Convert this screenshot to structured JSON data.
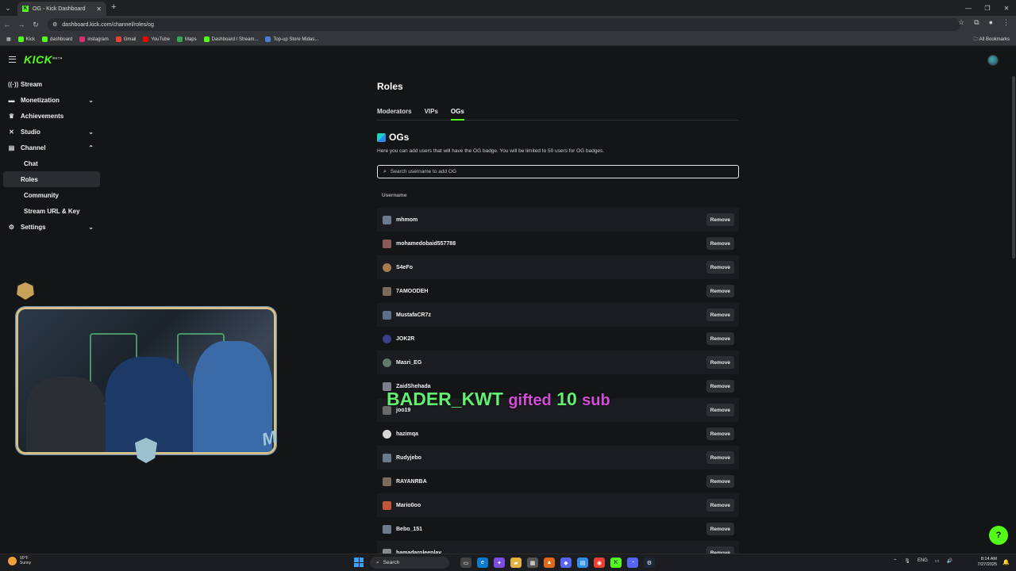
{
  "browser": {
    "tab_title": "OG - Kick Dashboard",
    "url": "dashboard.kick.com/channel/roles/og",
    "bookmarks": [
      "Kick",
      "dashboard",
      "instagram",
      "Gmail",
      "YouTube",
      "Maps",
      "Dashboard / Stream...",
      "Top-up Store Midas..."
    ],
    "all_bookmarks": "All Bookmarks"
  },
  "brand": {
    "logo": "KICK",
    "beta": "BETA"
  },
  "sidebar": {
    "stream": "Stream",
    "monetization": "Monetization",
    "achievements": "Achievements",
    "studio": "Studio",
    "channel": "Channel",
    "chat": "Chat",
    "roles": "Roles",
    "community": "Community",
    "stream_url": "Stream URL & Key",
    "settings": "Settings"
  },
  "main": {
    "title": "Roles",
    "tabs": [
      "Moderators",
      "VIPs",
      "OGs"
    ],
    "section_title": "OGs",
    "section_desc": "Here you can add users that will have the OG badge. You will be limited to 50 users for OG badges.",
    "search_placeholder": "Search username to add OG",
    "column_username": "Username",
    "remove_label": "Remove",
    "users": [
      "mhmom",
      "mohamedobaid557788",
      "S4eFo",
      "7AMOODEH",
      "MustafaCR7z",
      "JOK2R",
      "Masri_EG",
      "ZaidShehada",
      "joo19",
      "hazimqa",
      "Rudyjebo",
      "RAYANRBA",
      "Mario0oo",
      "Bebo_151",
      "hamadaroleeplay"
    ]
  },
  "alert": {
    "who": "BADER_KWT",
    "gifted": "gifted",
    "count": "10",
    "sub": "sub"
  },
  "taskbar": {
    "temp": "90°F",
    "weather": "Sunny",
    "search": "Search",
    "lang": "ENG",
    "time": "8:14 AM",
    "date": "7/27/2025"
  },
  "colors": {
    "accent": "#53fc18",
    "background": "#141517",
    "alert_green": "#62f070",
    "alert_purple": "#d24ed8"
  }
}
